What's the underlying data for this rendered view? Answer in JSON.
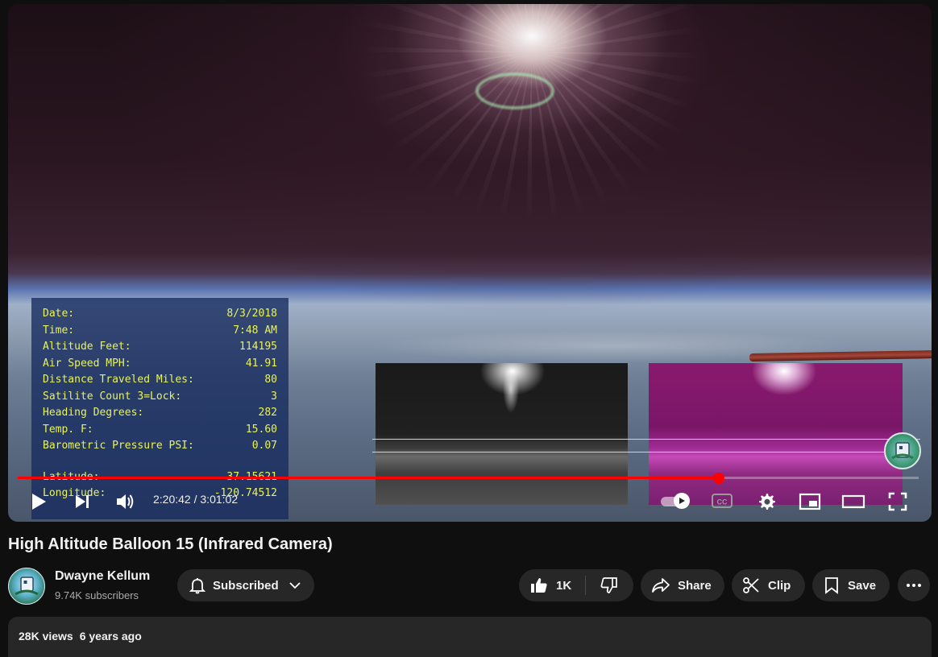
{
  "player": {
    "telemetry": [
      {
        "label": "Date:",
        "value": "8/3/2018"
      },
      {
        "label": "Time:",
        "value": "7:48 AM"
      },
      {
        "label": "Altitude Feet:",
        "value": "114195"
      },
      {
        "label": "Air Speed MPH:",
        "value": "41.91"
      },
      {
        "label": "Distance Traveled Miles:",
        "value": "80"
      },
      {
        "label": "Satilite Count 3=Lock:",
        "value": "3"
      },
      {
        "label": "Heading Degrees:",
        "value": "282"
      },
      {
        "label": "Temp. F:",
        "value": "15.60"
      },
      {
        "label": "Barometric Pressure PSI:",
        "value": "0.07"
      }
    ],
    "telemetry_lower": [
      {
        "label": "Latitude:",
        "value": "37.15621"
      },
      {
        "label": "Longitude:",
        "value": "-120.74512"
      }
    ],
    "progress_fraction": 0.778,
    "time_current": "2:20:42",
    "time_separator": " / ",
    "time_total": "3:01:02",
    "cc_label": "CC",
    "icons": [
      "play-icon",
      "next-icon",
      "volume-icon",
      "autoplay-toggle",
      "cc-icon",
      "settings-gear-icon",
      "miniplayer-icon",
      "theater-icon",
      "fullscreen-icon"
    ]
  },
  "video": {
    "title": "High Altitude Balloon 15 (Infrared Camera)"
  },
  "channel": {
    "name": "Dwayne Kellum",
    "subscribers": "9.74K subscribers",
    "subscribed_label": "Subscribed"
  },
  "actions": {
    "like_count": "1K",
    "share_label": "Share",
    "clip_label": "Clip",
    "save_label": "Save"
  },
  "description": {
    "views": "28K views",
    "age": "6 years ago"
  },
  "colors": {
    "background": "#0f0f0f",
    "pill": "#272727",
    "progress": "#ff0000",
    "telemetry_text": "#e8f35a"
  }
}
